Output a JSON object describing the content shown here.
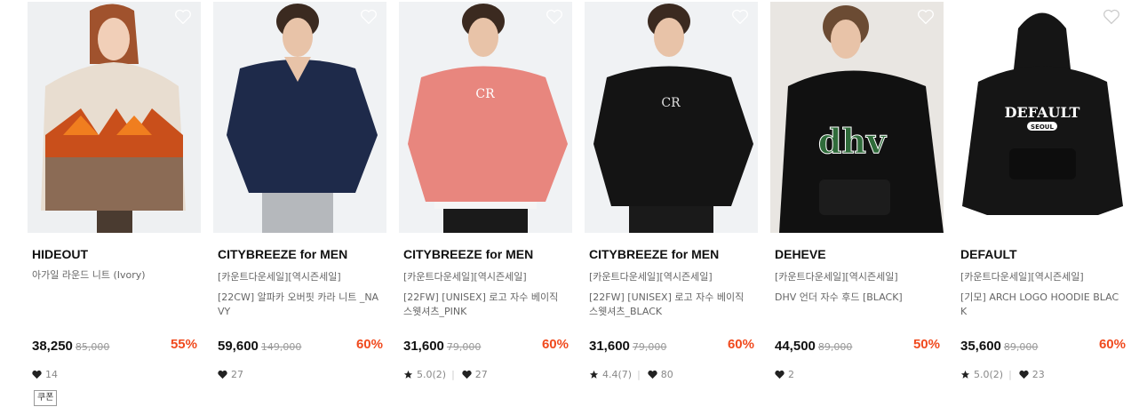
{
  "products": [
    {
      "brand": "HIDEOUT",
      "tag": "",
      "name": "아가일 라운드 니트 (Ivory)",
      "price": "38,250",
      "original_price": "85,000",
      "discount": "55%",
      "rating": "",
      "likes": "14",
      "coupon": "쿠폰"
    },
    {
      "brand": "CITYBREEZE for MEN",
      "tag": "[카운트다운세일][역시즌세일]",
      "name": "[22CW] 알파카 오버핏 카라 니트 _NAVY",
      "price": "59,600",
      "original_price": "149,000",
      "discount": "60%",
      "rating": "",
      "likes": "27"
    },
    {
      "brand": "CITYBREEZE for MEN",
      "tag": "[카운트다운세일][역시즌세일]",
      "name": "[22FW] [UNISEX] 로고 자수 베이직 스웻셔츠_PINK",
      "price": "31,600",
      "original_price": "79,000",
      "discount": "60%",
      "rating": "5.0(2)",
      "likes": "27"
    },
    {
      "brand": "CITYBREEZE for MEN",
      "tag": "[카운트다운세일][역시즌세일]",
      "name": "[22FW] [UNISEX] 로고 자수 베이직 스웻셔츠_BLACK",
      "price": "31,600",
      "original_price": "79,000",
      "discount": "60%",
      "rating": "4.4(7)",
      "likes": "80"
    },
    {
      "brand": "DEHEVE",
      "tag": "[카운트다운세일][역시즌세일]",
      "name": "DHV 언더 자수 후드 [BLACK]",
      "price": "44,500",
      "original_price": "89,000",
      "discount": "50%",
      "rating": "",
      "likes": "2"
    },
    {
      "brand": "DEFAULT",
      "tag": "[카운트다운세일][역시즌세일]",
      "name": "[기모] ARCH LOGO HOODIE BLACK",
      "price": "35,600",
      "original_price": "89,000",
      "discount": "60%",
      "rating": "5.0(2)",
      "likes": "23"
    }
  ],
  "image_labels": {
    "p3_logo": "CR",
    "p4_logo": "CR",
    "p5_logo": "dhv",
    "p6_logo": "DEFAULT",
    "p6_sublogo": "SEOUL"
  },
  "colors": {
    "discount": "#f04a1e",
    "price": "#111111",
    "muted": "#888888"
  }
}
